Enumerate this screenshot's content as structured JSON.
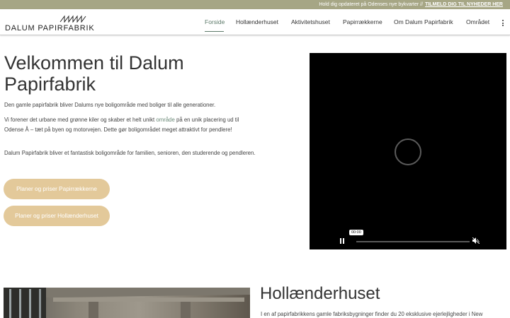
{
  "topbar": {
    "message": "Hold dig opdateret på Odenses nye bykvarter //",
    "link": "TILMELD DIG TIL NYHEDER HER"
  },
  "logo": {
    "text": "DALUM PAPIRFABRIK",
    "icon": "factory-roof-icon"
  },
  "nav": {
    "items": [
      "Forside",
      "Hollænderhuset",
      "Aktivitetshuset",
      "Papirrækkerne",
      "Om Dalum Papirfabrik",
      "Området"
    ],
    "active": "Forside",
    "more_icon": "kebab-menu-icon"
  },
  "hero": {
    "title": "Velkommen til Dalum Papirfabrik",
    "p1": "Den gamle papirfabrik bliver Dalums nye boligområde med boliger til alle generationer.",
    "p2_before": "Vi forener det urbane med grønne kiler og skaber et helt unikt ",
    "p2_link": "område",
    "p2_after": " på en unik placering ud til Odense Å – tæt på byen og motorvejen. Dette gør boligområdet meget attraktivt for pendlere!",
    "p3": "Dalum Papirfabrik bliver et fantastisk boligområde for familien, senioren, den studerende og pendleren.",
    "button1": "Planer og priser Papirrækkerne",
    "button2": "Planer og priser Hollænderhuset"
  },
  "video": {
    "time": "00:00",
    "progress": 0.0,
    "icons": [
      "pause-icon",
      "mute-icon",
      "loading-spinner"
    ]
  },
  "section": {
    "title": "Hollænderhuset",
    "text": "I en af papirfabrikkens gamle fabriksbygninger finder du 20 eksklusive ejerlejligheder i New"
  },
  "colors": {
    "topbar": "#a6a685",
    "button": "#e3c99a",
    "accent": "#5d7a6a"
  }
}
